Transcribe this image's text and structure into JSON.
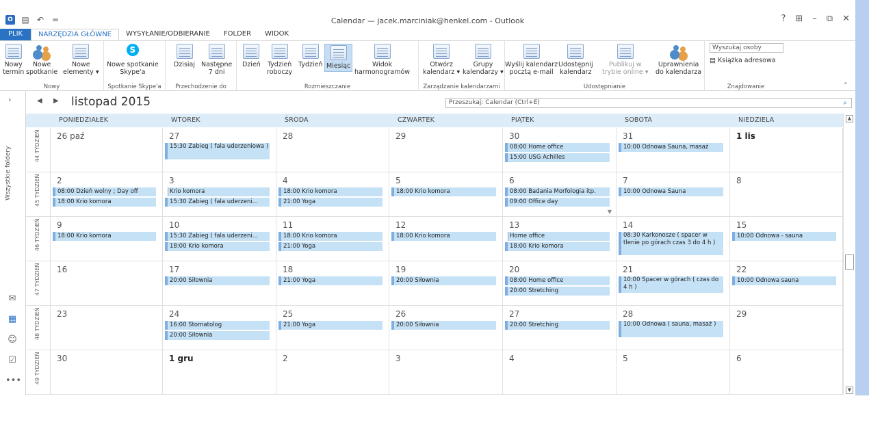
{
  "window": {
    "title": "Calendar — jacek.marciniak@henkel.com - Outlook",
    "controls": [
      "?",
      "⊞",
      "–",
      "⧉",
      "✕"
    ]
  },
  "qat": {
    "undo": "↶",
    "more": "="
  },
  "tabs": [
    "PLIK",
    "NARZĘDZIA GŁÓWNE",
    "WYSYŁANIE/ODBIERANIE",
    "FOLDER",
    "WIDOK"
  ],
  "ribbon": {
    "groups": {
      "nowy": "Nowy",
      "skype": "Spotkanie Skype'a",
      "przechodzenie": "Przechodzenie do",
      "rozmieszczanie": "Rozmieszczanie",
      "zarzadzanie": "Zarządzanie kalendarzami",
      "udostepnianie": "Udostępnianie",
      "znajdowanie": "Znajdowanie"
    },
    "buttons": {
      "nowy_termin": "Nowy\ntermin",
      "nowe_spotkanie": "Nowe\nspotkanie",
      "nowe_elementy": "Nowe\nelementy ▾",
      "skype": "Nowe spotkanie\nSkype'a",
      "dzisiaj": "Dzisiaj",
      "nastepne": "Następne\n7 dni",
      "dzien": "Dzień",
      "tydzien_roboczy": "Tydzień\nroboczy",
      "tydzien": "Tydzień",
      "miesiac": "Miesiąc",
      "harmonogram": "Widok\nharmonogramów",
      "otworz": "Otwórz\nkalendarz ▾",
      "grupy": "Grupy\nkalendarzy ▾",
      "wyslij": "Wyślij kalendarz\npocztą e-mail",
      "udostepnij": "Udostępnij\nkalendarz",
      "publikuj": "Publikuj w\ntrybie online ▾",
      "uprawnienia": "Uprawnienia\ndo kalendarza"
    },
    "search_people_placeholder": "Wyszukaj osoby",
    "address_book": "Książka adresowa"
  },
  "nav": {
    "folders_label": "Wszystkie foldery"
  },
  "calendar": {
    "month": "listopad 2015",
    "search_placeholder": "Przeszukaj: Calendar (Ctrl+E)",
    "days": [
      "PONIEDZIAŁEK",
      "WTOREK",
      "ŚRODA",
      "CZWARTEK",
      "PIĄTEK",
      "SOBOTA",
      "NIEDZIELA"
    ],
    "weeks": [
      {
        "label": "44 TYDZIEŃ",
        "days": [
          {
            "num": "26 paź",
            "events": []
          },
          {
            "num": "27",
            "events": [
              {
                "t": "15:30 Zabieg ( fala uderzeniowa )",
                "tall": true
              }
            ]
          },
          {
            "num": "28",
            "events": []
          },
          {
            "num": "29",
            "events": []
          },
          {
            "num": "30",
            "events": [
              {
                "t": "08:00 Home office"
              },
              {
                "t": "15:00 USG Achilles"
              }
            ]
          },
          {
            "num": "31",
            "events": [
              {
                "t": "10:00 Odnowa Sauna, masaż"
              }
            ]
          },
          {
            "num": "1 lis",
            "bold": true,
            "events": []
          }
        ]
      },
      {
        "label": "45 TYDZIEŃ",
        "days": [
          {
            "num": "2",
            "events": [
              {
                "t": "08:00 Dzień wolny ; Day off"
              },
              {
                "t": "18:00 Krio komora"
              }
            ]
          },
          {
            "num": "3",
            "events": [
              {
                "t": "Krio komora",
                "partial": true
              },
              {
                "t": "15:30 Zabieg ( fala uderzeni..."
              }
            ]
          },
          {
            "num": "4",
            "events": [
              {
                "t": "18:00 Krio komora"
              },
              {
                "t": "21:00 Yoga"
              }
            ]
          },
          {
            "num": "5",
            "events": [
              {
                "t": "18:00 Krio komora"
              }
            ]
          },
          {
            "num": "6",
            "events": [
              {
                "t": "08:00 Badania Morfologia itp."
              },
              {
                "t": "09:00 Office day"
              }
            ],
            "more": "▼"
          },
          {
            "num": "7",
            "events": [
              {
                "t": "10:00 Odnowa Sauna"
              }
            ]
          },
          {
            "num": "8",
            "events": []
          }
        ]
      },
      {
        "label": "46 TYDZIEŃ",
        "days": [
          {
            "num": "9",
            "events": [
              {
                "t": "18:00 Krio komora"
              }
            ]
          },
          {
            "num": "10",
            "events": [
              {
                "t": "15:30 Zabieg ( fala uderzeni..."
              },
              {
                "t": "18:00 Krio komora"
              }
            ]
          },
          {
            "num": "11",
            "events": [
              {
                "t": "18:00 Krio komora"
              },
              {
                "t": "21:00 Yoga"
              }
            ]
          },
          {
            "num": "12",
            "events": [
              {
                "t": "18:00 Krio komora"
              }
            ]
          },
          {
            "num": "13",
            "events": [
              {
                "t": "Home office",
                "partial": true
              },
              {
                "t": "18:00 Krio komora"
              }
            ]
          },
          {
            "num": "14",
            "events": [
              {
                "t": "08:30 Karkonosze ( spacer w tlenie po górach czas 3 do 4 h )",
                "tall3": true
              }
            ]
          },
          {
            "num": "15",
            "events": [
              {
                "t": "10:00 Odnowa - sauna"
              }
            ]
          }
        ]
      },
      {
        "label": "47 TYDZIEŃ",
        "days": [
          {
            "num": "16",
            "events": []
          },
          {
            "num": "17",
            "events": [
              {
                "t": "20:00 Siłownia"
              }
            ]
          },
          {
            "num": "18",
            "events": [
              {
                "t": "21:00 Yoga"
              }
            ]
          },
          {
            "num": "19",
            "events": [
              {
                "t": "20:00 Siłownia"
              }
            ]
          },
          {
            "num": "20",
            "events": [
              {
                "t": "08:00 Home office"
              },
              {
                "t": "20:00 Stretching"
              }
            ]
          },
          {
            "num": "21",
            "events": [
              {
                "t": "10:00 Spacer w górach ( czas do 4 h )",
                "tall": true
              }
            ]
          },
          {
            "num": "22",
            "events": [
              {
                "t": "10:00 Odnowa sauna"
              }
            ]
          }
        ]
      },
      {
        "label": "48 TYDZIEŃ",
        "days": [
          {
            "num": "23",
            "events": []
          },
          {
            "num": "24",
            "events": [
              {
                "t": "16:00 Stomatolog"
              },
              {
                "t": "20:00 Siłownia"
              }
            ]
          },
          {
            "num": "25",
            "events": [
              {
                "t": "21:00 Yoga"
              }
            ]
          },
          {
            "num": "26",
            "events": [
              {
                "t": "20:00 Siłownia"
              }
            ]
          },
          {
            "num": "27",
            "events": [
              {
                "t": "20:00 Stretching"
              }
            ]
          },
          {
            "num": "28",
            "events": [
              {
                "t": "10:00 Odnowa ( sauna, masaż )",
                "tall": true
              }
            ]
          },
          {
            "num": "29",
            "events": []
          }
        ]
      },
      {
        "label": "49 TYDZIEŃ",
        "days": [
          {
            "num": "30",
            "events": []
          },
          {
            "num": "1 gru",
            "bold": true,
            "events": []
          },
          {
            "num": "2",
            "events": []
          },
          {
            "num": "3",
            "events": []
          },
          {
            "num": "4",
            "events": []
          },
          {
            "num": "5",
            "events": []
          },
          {
            "num": "6",
            "events": []
          }
        ]
      }
    ]
  }
}
